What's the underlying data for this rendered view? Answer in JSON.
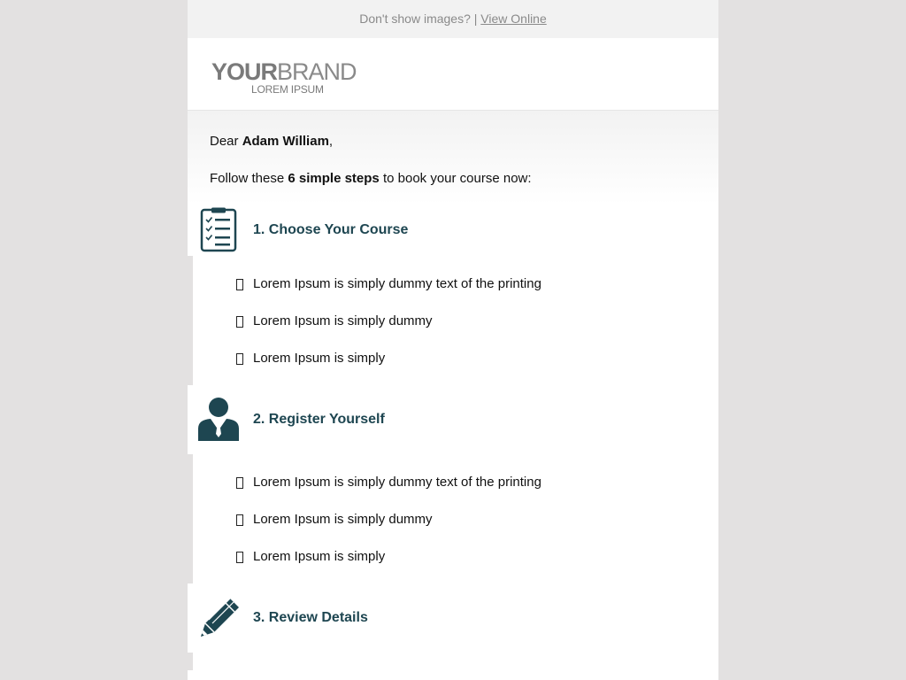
{
  "header": {
    "prompt_text": "Don't show images? |",
    "view_online_label": "View Online"
  },
  "brand": {
    "logo_bold": "YOUR",
    "logo_regular": "BRAND",
    "logo_sub": "LOREM IPSUM"
  },
  "intro": {
    "dear": "Dear",
    "name": "Adam William",
    "comma": ",",
    "follow_before": "Follow these",
    "follow_bold": "6 simple steps",
    "follow_after": "to book your course now:"
  },
  "steps": [
    {
      "title": "1. Choose Your Course",
      "icon": "clipboard-checklist-icon",
      "bullets": [
        "Lorem Ipsum is simply dummy text of the printing",
        "Lorem Ipsum is simply dummy",
        "Lorem Ipsum is simply"
      ]
    },
    {
      "title": "2. Register Yourself",
      "icon": "person-icon",
      "bullets": [
        "Lorem Ipsum is simply dummy text of the printing",
        "Lorem Ipsum is simply dummy",
        "Lorem Ipsum is simply"
      ]
    },
    {
      "title": "3. Review Details",
      "icon": "pencil-icon",
      "bullets": []
    }
  ],
  "colors": {
    "accent": "#1e4651",
    "page_bg": "#e3e1e1"
  }
}
